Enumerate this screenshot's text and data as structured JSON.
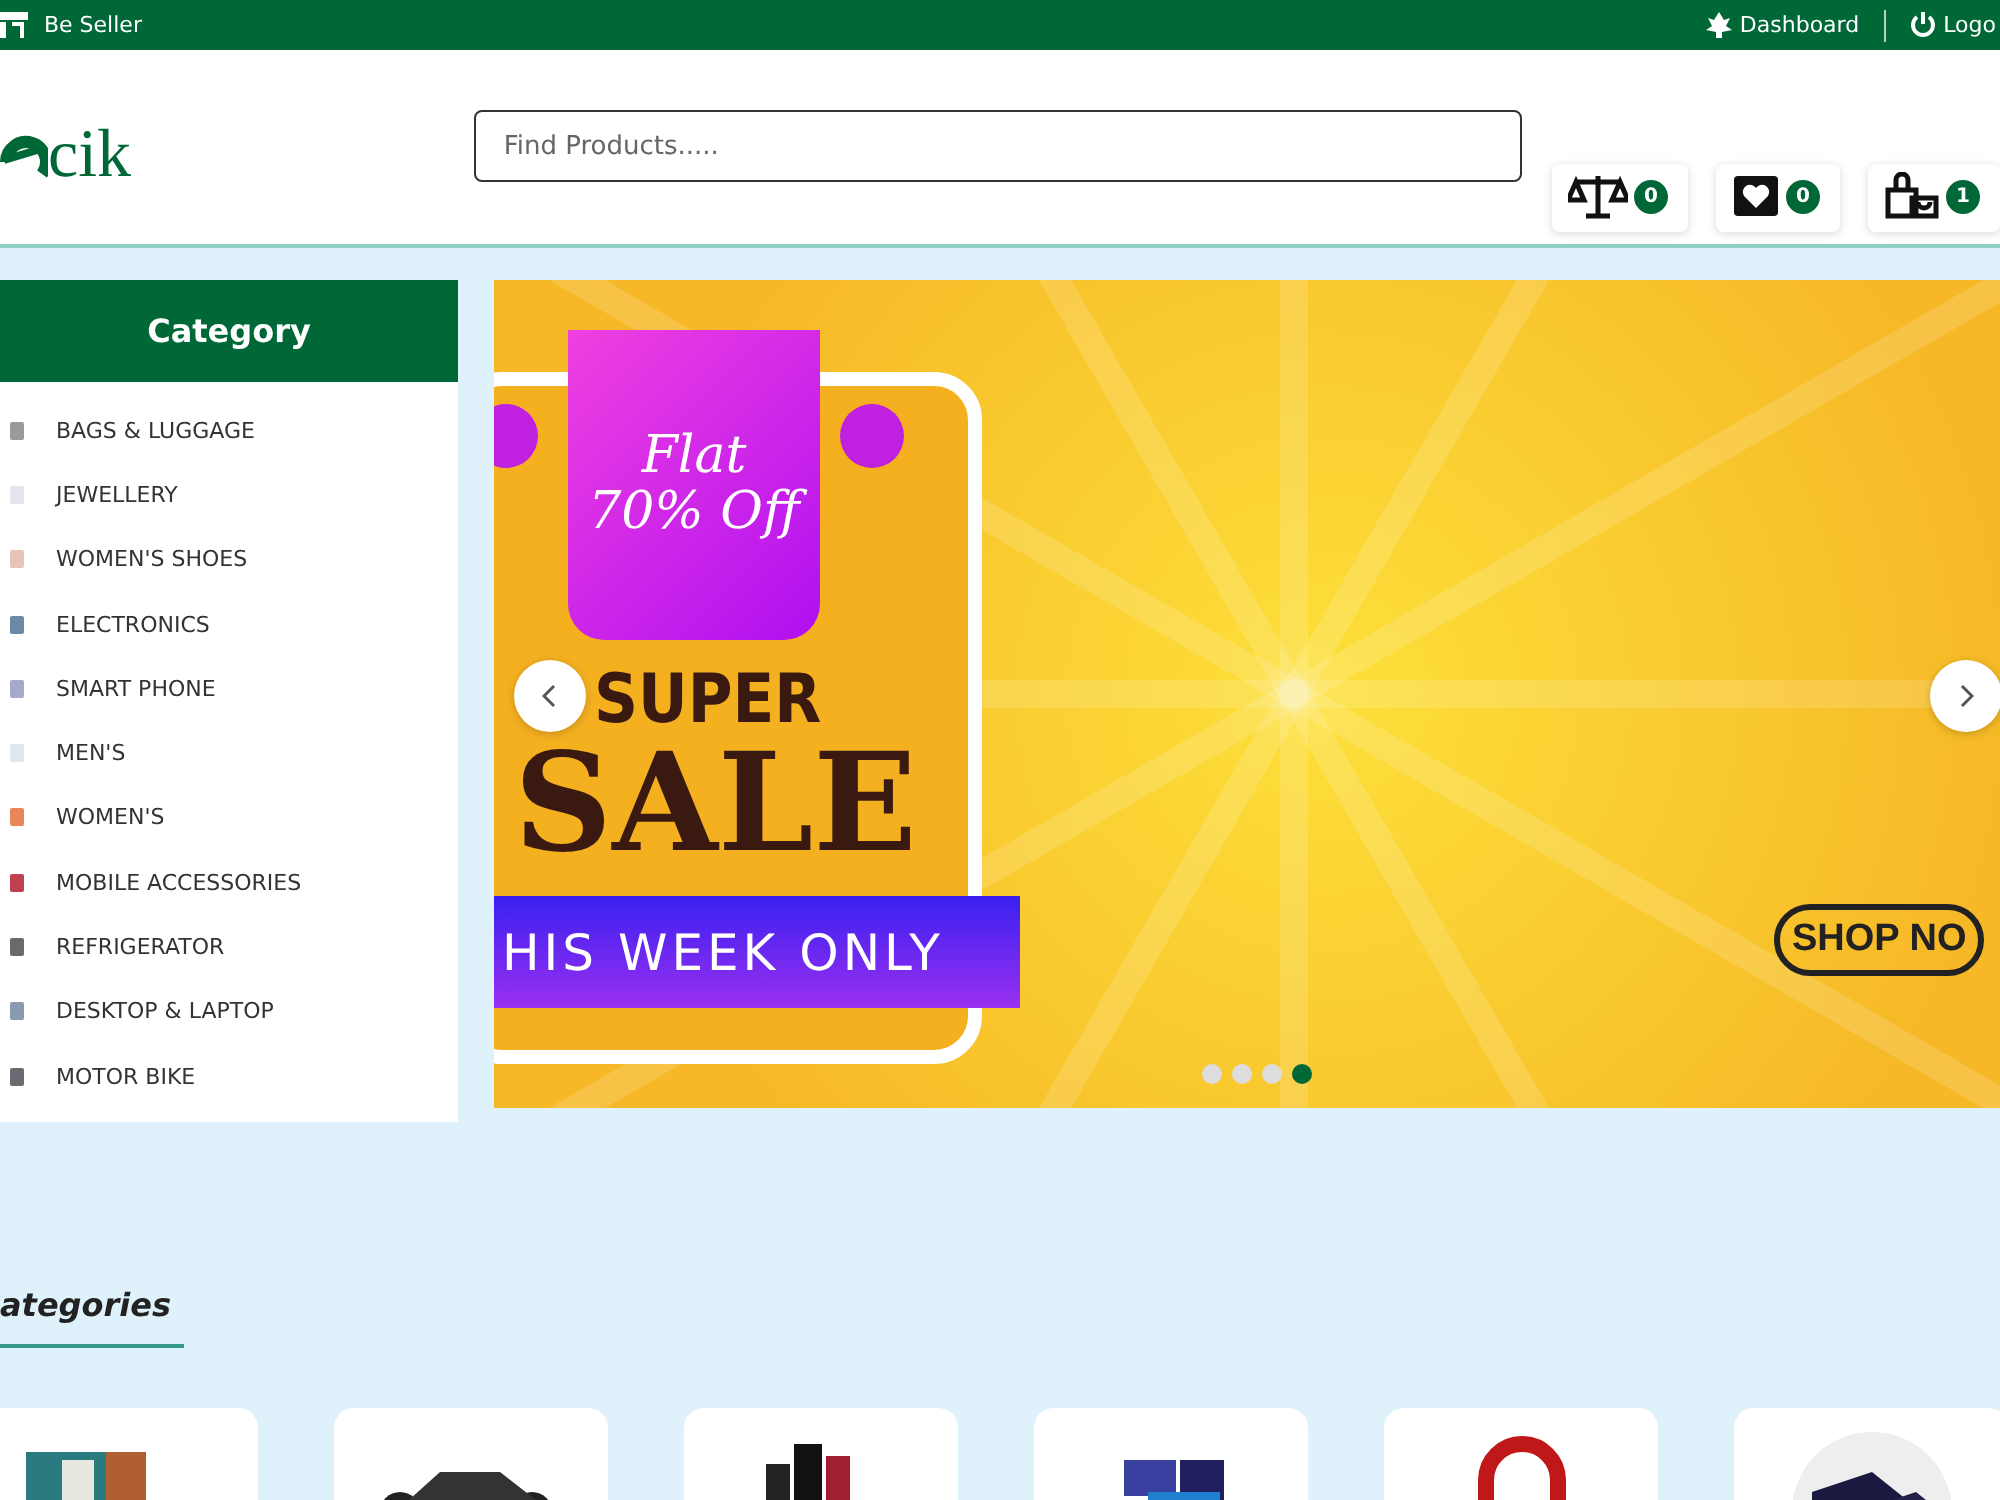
{
  "top_bar": {
    "seller_link": "Be Seller",
    "links": [
      {
        "kind": "dashboard",
        "label": "Dashboard"
      },
      {
        "kind": "logout",
        "label": "Logo"
      }
    ]
  },
  "header": {
    "logo": "cik",
    "search": {
      "placeholder": "Find Products....."
    },
    "actions": [
      {
        "kind": "compare",
        "count": "0"
      },
      {
        "kind": "wishlist",
        "count": "0"
      },
      {
        "kind": "cart",
        "count": "1"
      }
    ]
  },
  "sidebar": {
    "title": "Category",
    "items": [
      {
        "label": "BAGS & LUGGAGE",
        "color": "#9a9a9a"
      },
      {
        "label": "JEWELLERY",
        "color": "#e4e4ea"
      },
      {
        "label": "WOMEN'S SHOES",
        "color": "#e8c4b8"
      },
      {
        "label": "ELECTRONICS",
        "color": "#6a8aa8"
      },
      {
        "label": "SMART PHONE",
        "color": "#a8a8c8"
      },
      {
        "label": "MEN'S",
        "color": "#e0e6ee"
      },
      {
        "label": "WOMEN'S",
        "color": "#e8865a"
      },
      {
        "label": "MOBILE ACCESSORIES",
        "color": "#c04050"
      },
      {
        "label": "REFRIGERATOR",
        "color": "#6a6a6a"
      },
      {
        "label": "DESKTOP & LAPTOP",
        "color": "#8a9ab0"
      },
      {
        "label": "MOTOR BIKE",
        "color": "#6a6a70"
      }
    ]
  },
  "banner": {
    "tag": "Flat 70% Off",
    "headline_1": "SUPER",
    "headline_2": "SALE",
    "ribbon": "HIS WEEK ONLY",
    "button": "SHOP NO",
    "dots": [
      {
        "selected": false
      },
      {
        "selected": false
      },
      {
        "selected": false
      },
      {
        "selected": true
      }
    ]
  },
  "categories_section": {
    "title": "ategories",
    "cards": [
      {
        "kind": "tv"
      },
      {
        "kind": "motorbike"
      },
      {
        "kind": "phones"
      },
      {
        "kind": "laptops"
      },
      {
        "kind": "headphones"
      },
      {
        "kind": "shoes"
      }
    ]
  }
}
